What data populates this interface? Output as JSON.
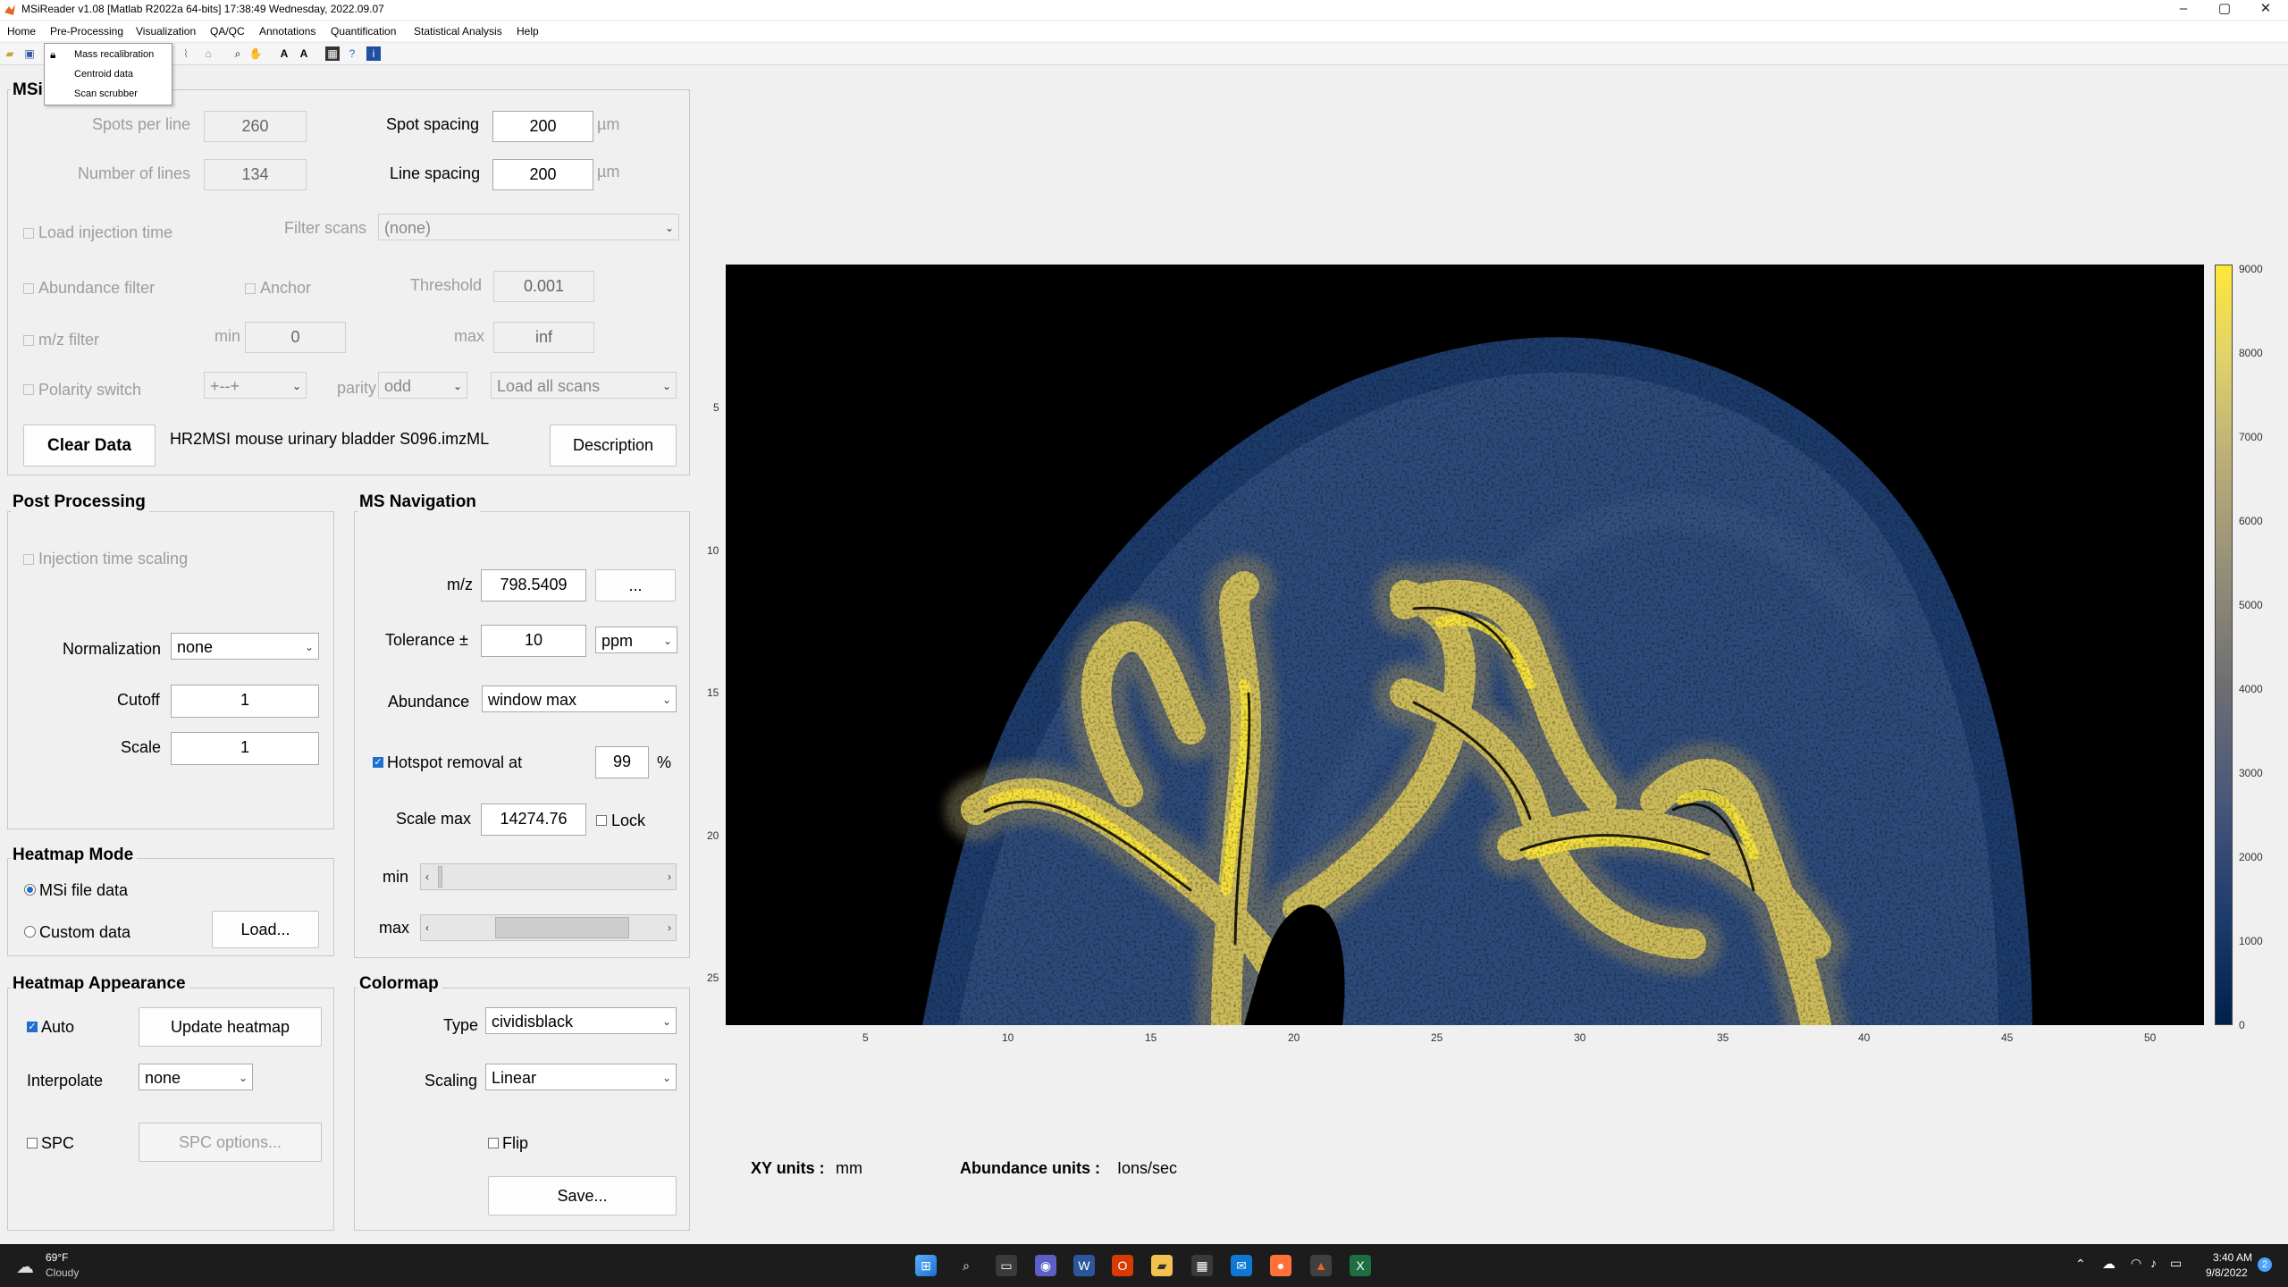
{
  "window": {
    "title": "MSiReader  v1.08  [Matlab R2022a 64-bits]  17:38:49 Wednesday, 2022.09.07",
    "minimize": "–",
    "maximize": "▢",
    "close": "✕"
  },
  "menu": {
    "items": [
      "Home",
      "Pre-Processing",
      "Visualization",
      "QA/QC",
      "Annotations",
      "Quantification",
      "Statistical Analysis",
      "Help"
    ],
    "dropdown": [
      "Mass recalibration",
      "Centroid data",
      "Scan scrubber"
    ]
  },
  "toolbar": {
    "icons": [
      "open-folder-icon",
      "save-icon",
      "lock-icon",
      "zoom-in-icon",
      "pan-icon",
      "text-a-icon",
      "text-a-icon",
      "image-icon",
      "help-icon",
      "info-icon"
    ]
  },
  "msi_panel": {
    "title": "MSi",
    "spots_per_line_label": "Spots per line",
    "spots_per_line": "260",
    "number_of_lines_label": "Number of lines",
    "number_of_lines": "134",
    "spot_spacing_label": "Spot spacing",
    "spot_spacing": "200",
    "line_spacing_label": "Line spacing",
    "line_spacing": "200",
    "unit_um": "µm",
    "load_injection_time": "Load injection time",
    "filter_scans_label": "Filter scans",
    "filter_scans_value": "(none)",
    "abundance_filter": "Abundance filter",
    "anchor": "Anchor",
    "threshold_label": "Threshold",
    "threshold": "0.001",
    "mz_filter": "m/z filter",
    "min_label": "min",
    "min_value": "0",
    "max_label": "max",
    "max_value": "inf",
    "polarity_switch": "Polarity switch",
    "polarity_value": "+--+",
    "parity_label": "parity",
    "parity_value": "odd",
    "load_scans_value": "Load all scans",
    "clear_data": "Clear Data",
    "file_name": "HR2MSI mouse urinary bladder S096.imzML",
    "description": "Description"
  },
  "post_processing": {
    "title": "Post Processing",
    "injection_time_scaling": "Injection time scaling",
    "normalization_label": "Normalization",
    "normalization_value": "none",
    "cutoff_label": "Cutoff",
    "cutoff_value": "1",
    "scale_label": "Scale",
    "scale_value": "1"
  },
  "ms_navigation": {
    "title": "MS Navigation",
    "mz_label": "m/z",
    "mz_value": "798.5409",
    "more_button": "...",
    "tolerance_label": "Tolerance ±",
    "tolerance_value": "10",
    "tolerance_unit": "ppm",
    "abundance_label": "Abundance",
    "abundance_value": "window max",
    "hotspot_label": "Hotspot removal at",
    "hotspot_value": "99",
    "percent": "%",
    "scale_max_label": "Scale max",
    "scale_max_value": "14274.76",
    "lock_label": "Lock",
    "min_label": "min",
    "max_label": "max",
    "min_level": 0.02,
    "max_level": 0.63
  },
  "heatmap_mode": {
    "title": "Heatmap Mode",
    "msi_file_data": "MSi file data",
    "custom_data": "Custom data",
    "load_button": "Load..."
  },
  "heatmap_appearance": {
    "title": "Heatmap Appearance",
    "auto": "Auto",
    "update_heatmap": "Update heatmap",
    "interpolate_label": "Interpolate",
    "interpolate_value": "none",
    "spc": "SPC",
    "spc_options": "SPC options..."
  },
  "colormap": {
    "title": "Colormap",
    "type_label": "Type",
    "type_value": "cividisblack",
    "scaling_label": "Scaling",
    "scaling_value": "Linear",
    "flip": "Flip",
    "save": "Save..."
  },
  "plot": {
    "x_ticks": [
      "5",
      "10",
      "15",
      "20",
      "25",
      "30",
      "35",
      "40",
      "45",
      "50"
    ],
    "y_ticks": [
      "5",
      "10",
      "15",
      "20",
      "25"
    ],
    "colorbar_ticks": [
      "9000",
      "8000",
      "7000",
      "6000",
      "5000",
      "4000",
      "3000",
      "2000",
      "1000",
      "0"
    ],
    "xy_units_label": "XY units :",
    "xy_units": "mm",
    "abundance_units_label": "Abundance units :",
    "abundance_units": "Ions/sec",
    "colors": {
      "low": "#00204c",
      "mid": "#7c7b78",
      "high": "#fde838",
      "background": "#000000"
    }
  },
  "taskbar": {
    "weather_temp": "69°F",
    "weather_desc": "Cloudy",
    "time": "3:40 AM",
    "date": "9/8/2022",
    "notification_count": "2"
  }
}
